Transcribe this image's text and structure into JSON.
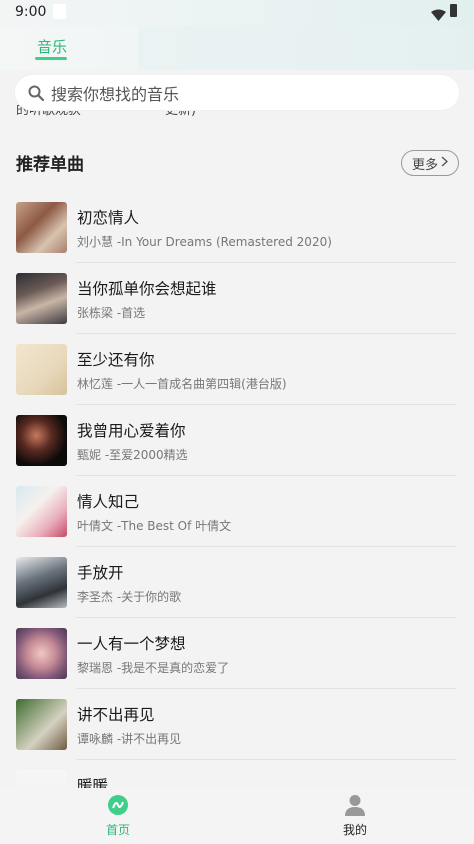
{
  "status_bar": {
    "time": "9:00"
  },
  "header": {
    "tab_music": "音乐"
  },
  "peek": {
    "left": "的听歌观获",
    "right": "更新)"
  },
  "search": {
    "placeholder": "搜索你想找的音乐"
  },
  "section": {
    "title": "推荐单曲",
    "more_label": "更多"
  },
  "songs": [
    {
      "title": "初恋情人",
      "subtitle": "刘小慧 -In Your Dreams (Remastered 2020)"
    },
    {
      "title": "当你孤单你会想起谁",
      "subtitle": "张栋梁 -首选"
    },
    {
      "title": "至少还有你",
      "subtitle": "林忆莲 -一人一首成名曲第四辑(港台版)"
    },
    {
      "title": "我曾用心爱着你",
      "subtitle": "甄妮 -至爱2000精选"
    },
    {
      "title": "情人知己",
      "subtitle": "叶倩文 -The Best Of 叶倩文"
    },
    {
      "title": "手放开",
      "subtitle": "李圣杰 -关于你的歌"
    },
    {
      "title": "一人有一个梦想",
      "subtitle": "黎瑞恩 -我是不是真的恋爱了"
    },
    {
      "title": "讲不出再见",
      "subtitle": "谭咏麟 -讲不出再见"
    },
    {
      "title": "暖暖",
      "subtitle": ""
    }
  ],
  "bottom_nav": {
    "home_label": "首页",
    "me_label": "我的"
  },
  "colors": {
    "accent": "#2db877",
    "background": "#f3f3f3"
  }
}
